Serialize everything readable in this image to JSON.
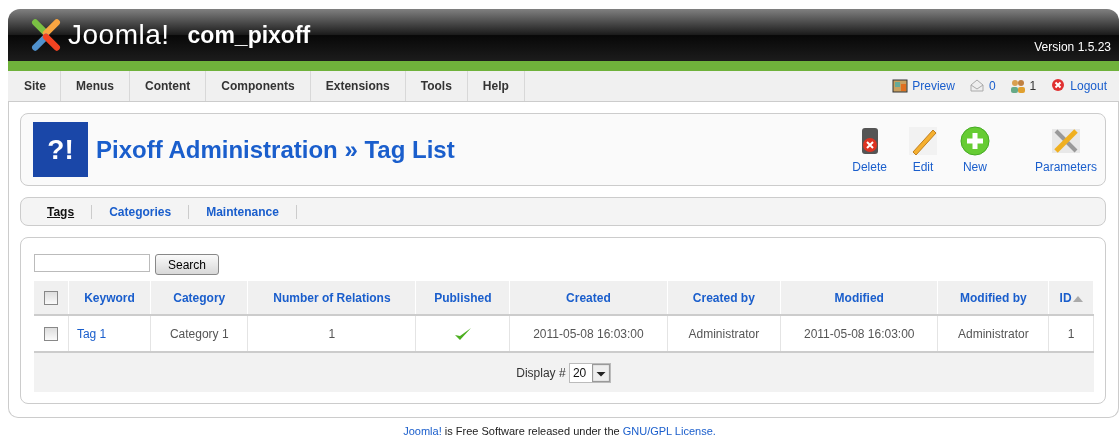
{
  "header": {
    "logo_text": "Joomla!",
    "title": "com_pixoff",
    "version": "Version 1.5.23"
  },
  "menu": [
    "Site",
    "Menus",
    "Content",
    "Components",
    "Extensions",
    "Tools",
    "Help"
  ],
  "status": [
    {
      "kind": "preview",
      "text": "Preview"
    },
    {
      "kind": "messages",
      "text": "0"
    },
    {
      "kind": "users",
      "text": "1"
    },
    {
      "kind": "logout",
      "text": "Logout"
    }
  ],
  "toolbar": {
    "title": "Pixoff Administration » Tag List",
    "logo_text": "?!",
    "buttons": [
      {
        "kind": "delete",
        "label": "Delete"
      },
      {
        "kind": "edit",
        "label": "Edit"
      },
      {
        "kind": "new",
        "label": "New"
      },
      {
        "kind": "parameters",
        "label": "Parameters"
      }
    ]
  },
  "submenu": [
    {
      "label": "Tags",
      "selected": true
    },
    {
      "label": "Categories",
      "selected": false
    },
    {
      "label": "Maintenance",
      "selected": false
    }
  ],
  "search": {
    "button": "Search"
  },
  "table": {
    "select_all_checked": false,
    "columns": [
      {
        "label": "Keyword",
        "sorted": false
      },
      {
        "label": "Category",
        "sorted": false
      },
      {
        "label": "Number of Relations",
        "sorted": false
      },
      {
        "label": "Published",
        "sorted": false
      },
      {
        "label": "Created",
        "sorted": false
      },
      {
        "label": "Created by",
        "sorted": false
      },
      {
        "label": "Modified",
        "sorted": false
      },
      {
        "label": "Modified by",
        "sorted": false
      },
      {
        "label": "ID",
        "sorted": true
      }
    ],
    "rows": [
      {
        "checked": false,
        "keyword": "Tag 1",
        "category": "Category 1",
        "relations": "1",
        "published": true,
        "created": "2011-05-08 16:03:00",
        "created_by": "Administrator",
        "modified": "2011-05-08 16:03:00",
        "modified_by": "Administrator",
        "id": "1"
      }
    ],
    "display_label": "Display #",
    "display_value": "20"
  },
  "footer": {
    "link1": "Joomla!",
    "text": " is Free Software released under the ",
    "link2": "GNU/GPL License."
  }
}
